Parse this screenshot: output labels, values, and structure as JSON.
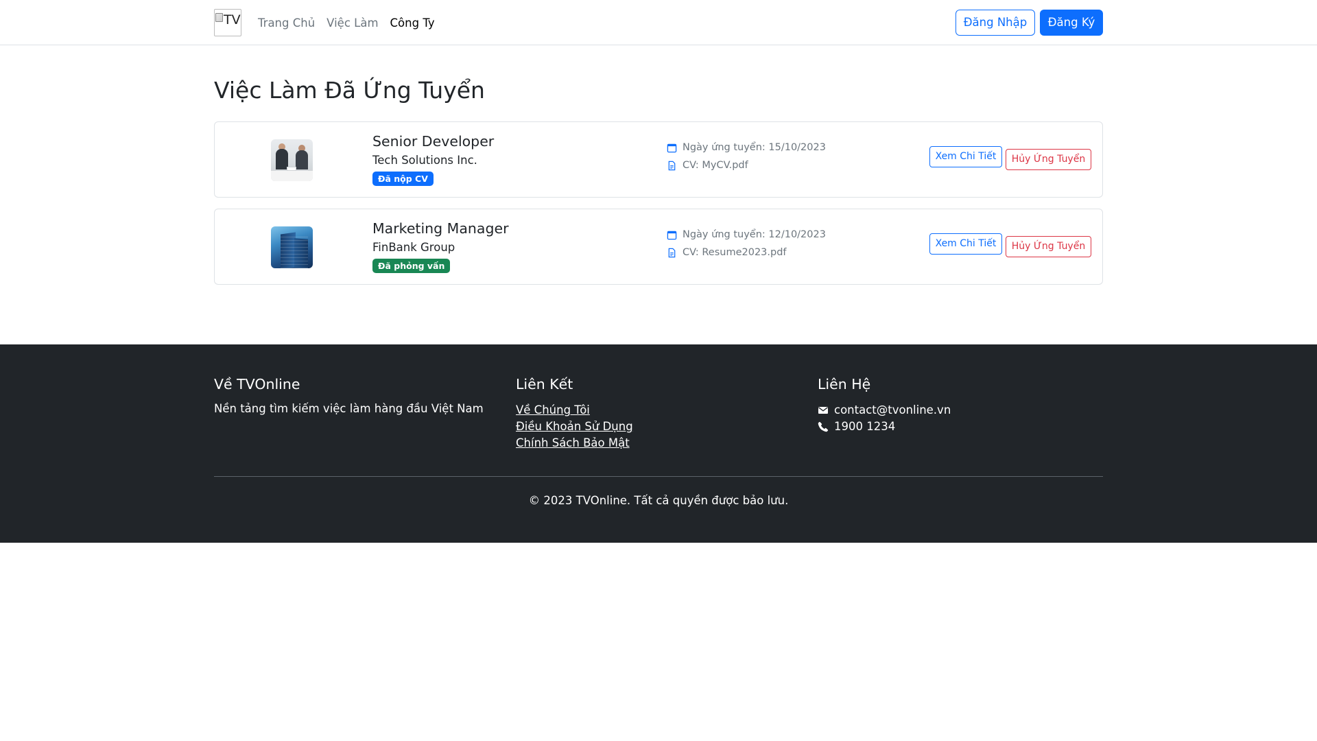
{
  "navbar": {
    "logo_alt": "TV",
    "links": [
      {
        "label": "Trang Chủ"
      },
      {
        "label": "Việc Làm"
      },
      {
        "label": "Công Ty"
      }
    ],
    "login_label": "Đăng Nhập",
    "register_label": "Đăng Ký"
  },
  "main": {
    "title": "Việc Làm Đã Ứng Tuyển",
    "applications": [
      {
        "title": "Senior Developer",
        "company": "Tech Solutions Inc.",
        "status": "Đã nộp CV",
        "date": "Ngày ứng tuyển: 15/10/2023",
        "cv": "CV: MyCV.pdf",
        "detail_label": "Xem Chi Tiết",
        "cancel_label": "Hủy Ứng Tuyển"
      },
      {
        "title": "Marketing Manager",
        "company": "FinBank Group",
        "status": "Đã phỏng vấn",
        "date": "Ngày ứng tuyển: 12/10/2023",
        "cv": "CV: Resume2023.pdf",
        "detail_label": "Xem Chi Tiết",
        "cancel_label": "Hủy Ứng Tuyển"
      }
    ]
  },
  "footer": {
    "about": {
      "heading": "Về TVOnline",
      "text": "Nền tảng tìm kiếm việc làm hàng đầu Việt Nam"
    },
    "links": {
      "heading": "Liên Kết",
      "items": [
        {
          "label": "Về Chúng Tôi"
        },
        {
          "label": "Điều Khoản Sử Dụng"
        },
        {
          "label": "Chính Sách Bảo Mật"
        }
      ]
    },
    "contact": {
      "heading": "Liên Hệ",
      "email": "contact@tvonline.vn",
      "phone": "1900 1234"
    },
    "copyright": "© 2023 TVOnline. Tất cả quyền được bảo lưu."
  },
  "colors": {
    "primary": "#0d6efd",
    "danger": "#dc3545",
    "success": "#198754",
    "footer_bg": "#212529",
    "muted": "#6c757d"
  },
  "icons": [
    "broken-image-icon",
    "calendar-icon",
    "file-icon",
    "envelope-icon",
    "phone-icon"
  ]
}
